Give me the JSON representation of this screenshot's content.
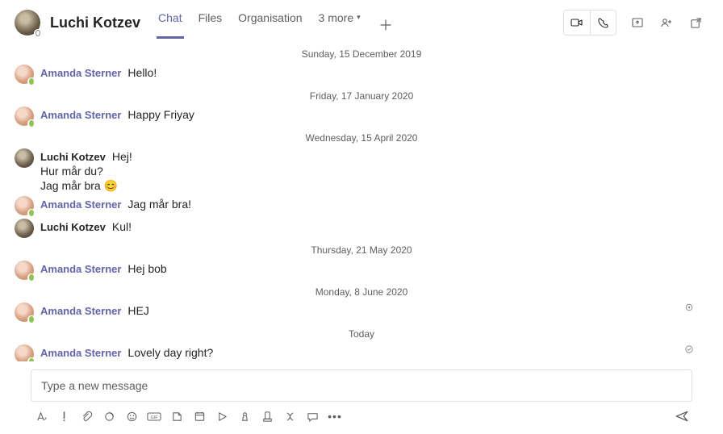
{
  "header": {
    "title": "Luchi Kotzev",
    "tabs": [
      "Chat",
      "Files",
      "Organisation"
    ],
    "more_label": "3 more"
  },
  "dates": {
    "d1": "Sunday, 15 December 2019",
    "d2": "Friday, 17 January 2020",
    "d3": "Wednesday, 15 April 2020",
    "d4": "Thursday, 21 May 2020",
    "d5": "Monday, 8 June 2020",
    "d6": "Today"
  },
  "senders": {
    "amanda": "Amanda Sterner",
    "luchi": "Luchi Kotzev"
  },
  "msgs": {
    "m1": "Hello!",
    "m2": "Happy Friyay",
    "m3_l1": "Hej!",
    "m3_l2": "Hur mår du?",
    "m3_l3": "Jag mår bra 😊",
    "m4": "Jag mår bra!",
    "m5": "Kul!",
    "m6": "Hej bob",
    "m7": "HEJ",
    "m8": "Lovely day right?"
  },
  "compose": {
    "placeholder": "Type a new message"
  }
}
